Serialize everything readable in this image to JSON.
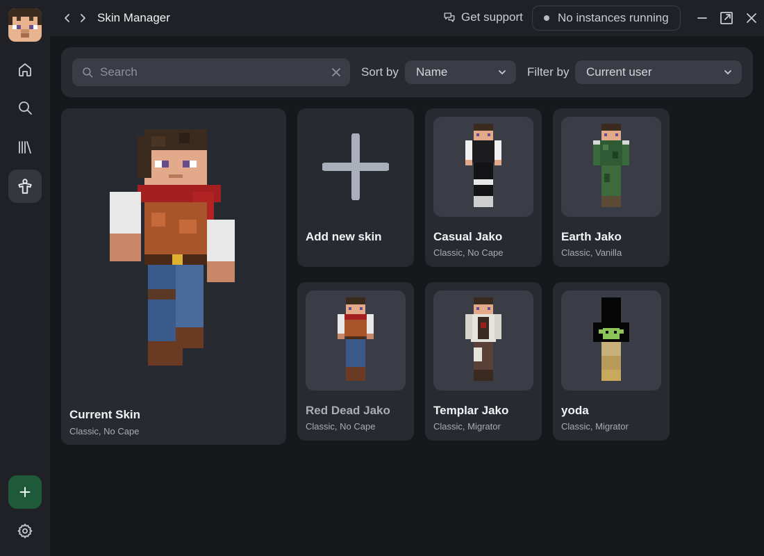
{
  "window": {
    "title": "Skin Manager"
  },
  "header": {
    "support_label": "Get support",
    "instances_label": "No instances running"
  },
  "toolbar": {
    "search_placeholder": "Search",
    "sort_label": "Sort by",
    "sort_value": "Name",
    "filter_label": "Filter by",
    "filter_value": "Current user"
  },
  "current_skin": {
    "name": "Current Skin",
    "meta": "Classic, No Cape"
  },
  "add_skin": {
    "label": "Add new skin"
  },
  "skins": [
    {
      "name": "Casual Jako",
      "meta": "Classic, No Cape"
    },
    {
      "name": "Earth Jako",
      "meta": "Classic, Vanilla"
    },
    {
      "name": "Red Dead Jako",
      "meta": "Classic, No Cape"
    },
    {
      "name": "Templar Jako",
      "meta": "Classic, Migrator"
    },
    {
      "name": "yoda",
      "meta": "Classic, Migrator"
    }
  ],
  "sidebar": {
    "items": [
      "home-icon",
      "search-icon",
      "library-icon",
      "skins-icon"
    ],
    "active": "skins-icon"
  },
  "colors": {
    "accent": "#1e5a3a",
    "background": "#16181c",
    "card": "#272a30"
  }
}
